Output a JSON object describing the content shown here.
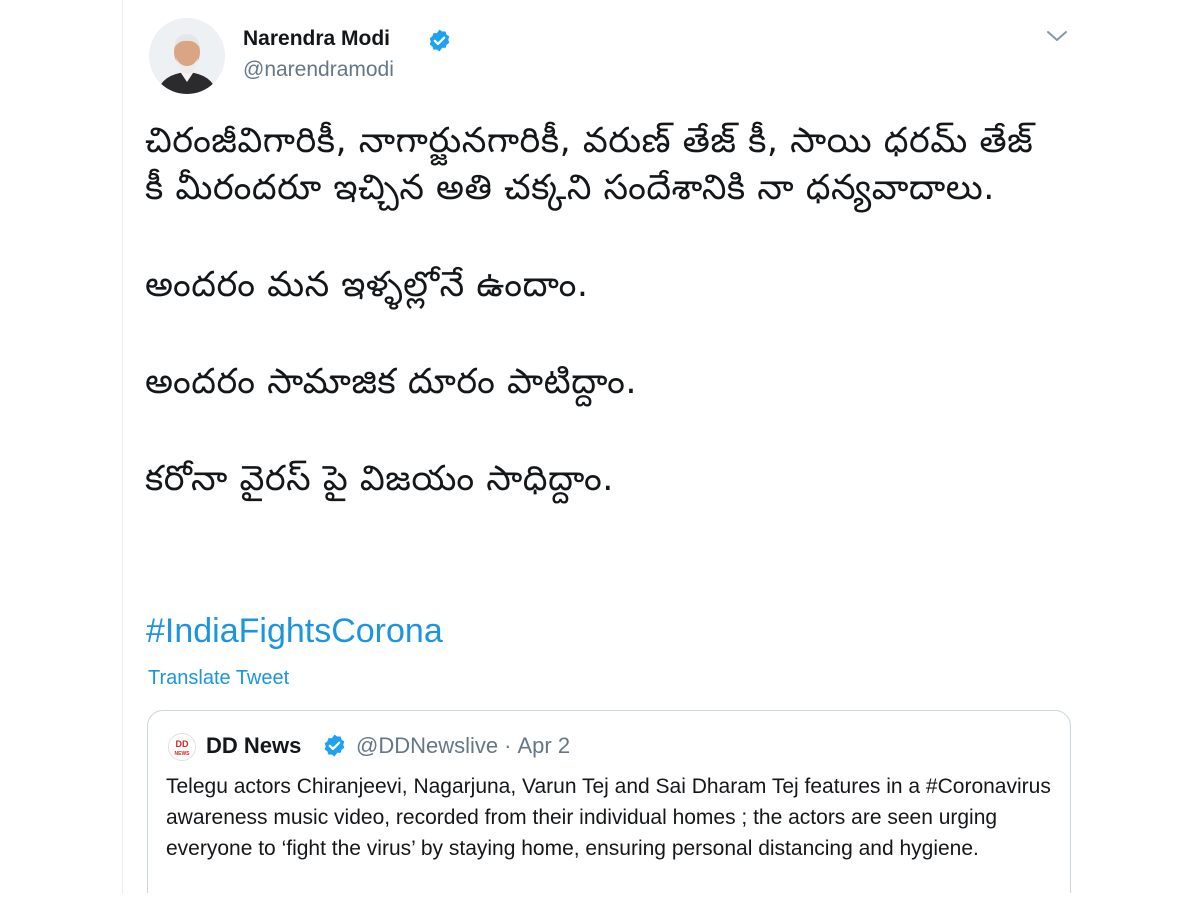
{
  "tweet": {
    "author": {
      "name": "Narendra Modi",
      "handle": "@narendramodi",
      "verified": true
    },
    "text_paragraphs": [
      "చిరంజీవిగారికీ, నాగార్జునగారికీ, వరుణ్ తేజ్ కీ, సాయి ధరమ్ తేజ్ కీ మీరందరూ ఇచ్చిన అతి చక్కని సందేశానికి నా ధన్యవాదాలు.",
      "అందరం మన ఇళ్ళల్లోనే ఉందాం.",
      "అందరం సామాజిక దూరం పాటిద్దాం.",
      "కరోనా వైరస్ పై విజయం సాధిద్దాం."
    ],
    "hashtag": "#IndiaFightsCorona",
    "translate_label": "Translate Tweet"
  },
  "quoted_tweet": {
    "logo_text": "DD NEWS",
    "author_name": "DD News",
    "handle": "@DDNewslive",
    "separator": "·",
    "date": "Apr 2",
    "verified": true,
    "text": "Telegu actors Chiranjeevi, Nagarjuna, Varun Tej and Sai Dharam Tej features in a #Coronavirus awareness music video, recorded from their individual homes ; the actors are seen urging everyone to ‘fight the virus’ by staying home, ensuring personal distancing and hygiene."
  },
  "colors": {
    "link_blue": "#1b95e0",
    "verified_blue": "#1da1f2",
    "secondary_text": "#657786",
    "border": "#ccd6dd"
  },
  "icons": {
    "verified": "verified-badge-icon",
    "menu": "chevron-down-icon",
    "dd_logo": "dd-news-logo"
  }
}
